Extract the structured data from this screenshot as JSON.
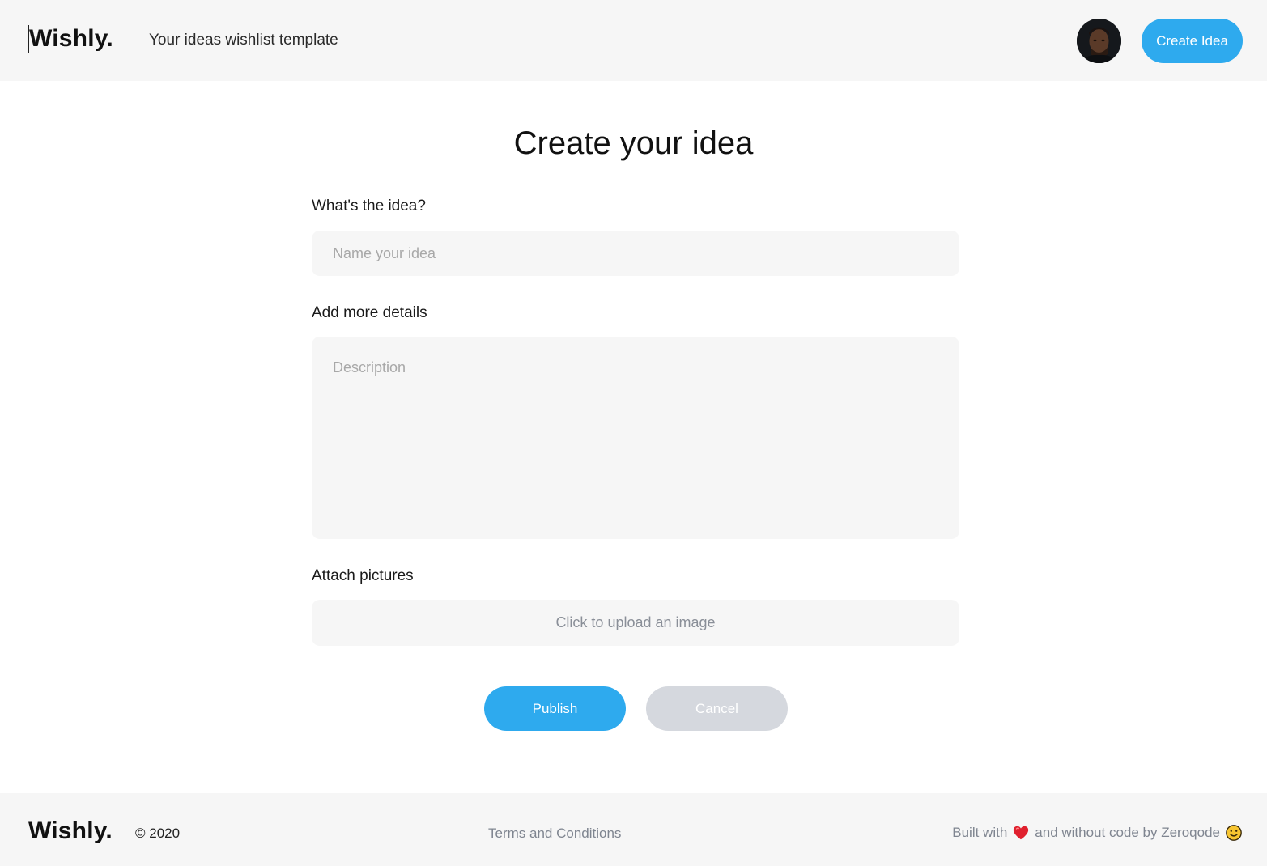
{
  "header": {
    "logo": "Wishly.",
    "tagline": "Your ideas wishlist template",
    "create_button": "Create Idea"
  },
  "form": {
    "title": "Create your idea",
    "idea_label": "What's the idea?",
    "idea_placeholder": "Name your idea",
    "idea_value": "",
    "details_label": "Add more details",
    "details_placeholder": "Description",
    "pictures_label": "Attach pictures",
    "upload_text": "Click to upload an image",
    "publish_label": "Publish",
    "cancel_label": "Cancel"
  },
  "footer": {
    "logo": "Wishly.",
    "copyright": "© 2020",
    "terms": "Terms and Conditions",
    "built_with": "Built with",
    "without_code": "and without code by Zeroqode"
  },
  "colors": {
    "accent": "#2eaaee",
    "cancel": "#d5d8de",
    "field_bg": "#f6f6f6"
  },
  "icons": {
    "heart": "heart-icon",
    "smile": "smile-icon"
  }
}
